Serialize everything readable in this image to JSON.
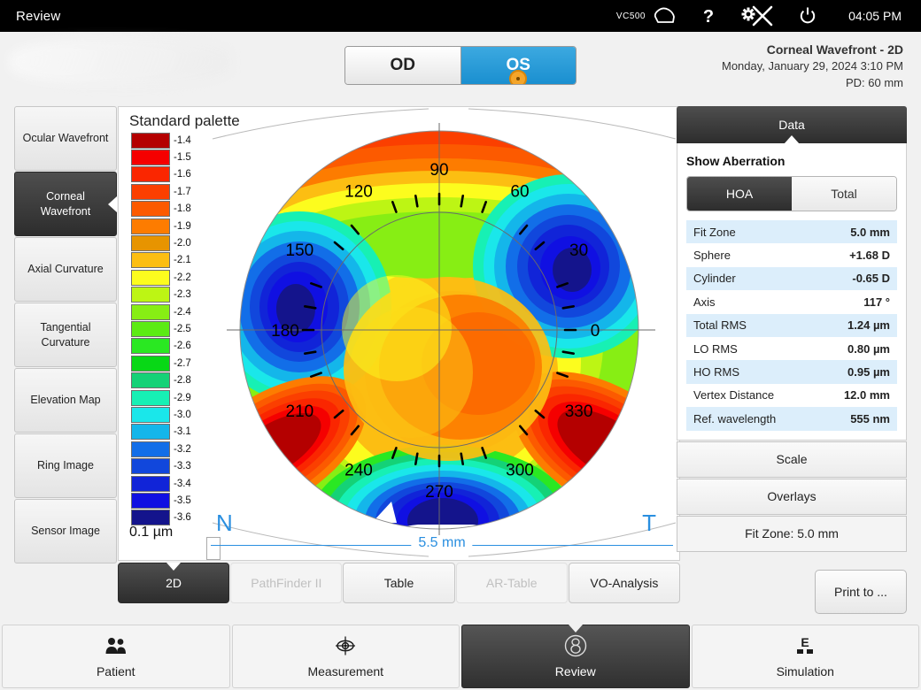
{
  "titlebar": {
    "title": "Review",
    "device_label": "VC500",
    "cloud_icon": "cloud-icon",
    "help_icon": "help-question-icon",
    "settings_disabled_icon": "gear-disabled-icon",
    "power_icon": "power-icon",
    "time": "04:05 PM"
  },
  "header": {
    "eye_od": "OD",
    "eye_os": "OS",
    "selected_eye": "OS",
    "exam_title": "Corneal Wavefront - 2D",
    "exam_datetime": "Monday, January 29, 2024 3:10 PM",
    "pd": "PD: 60 mm"
  },
  "sidebar": {
    "items": [
      {
        "label": "Ocular Wavefront",
        "active": false
      },
      {
        "label": "Corneal Wavefront",
        "active": true
      },
      {
        "label": "Axial Curvature",
        "active": false
      },
      {
        "label": "Tangential Curvature",
        "active": false
      },
      {
        "label": "Elevation Map",
        "active": false
      },
      {
        "label": "Ring Image",
        "active": false
      },
      {
        "label": "Sensor Image",
        "active": false
      }
    ]
  },
  "map": {
    "palette_title": "Standard palette",
    "palette_unit": "0.1 µm",
    "scale_label": "5.5 mm",
    "nasal_label": "N",
    "temporal_label": "T",
    "axis_labels": [
      "0",
      "30",
      "60",
      "90",
      "120",
      "150",
      "180",
      "210",
      "240",
      "270",
      "300",
      "330"
    ],
    "palette_steps": [
      {
        "value": "-1.4",
        "color": "#b40000"
      },
      {
        "value": "-1.5",
        "color": "#f50000"
      },
      {
        "value": "-1.6",
        "color": "#fa2600"
      },
      {
        "value": "-1.7",
        "color": "#fb3f00"
      },
      {
        "value": "-1.8",
        "color": "#fc5a00"
      },
      {
        "value": "-1.9",
        "color": "#fd7c00"
      },
      {
        "value": "-2.0",
        "color": "#e79400"
      },
      {
        "value": "-2.1",
        "color": "#fcbe12"
      },
      {
        "value": "-2.2",
        "color": "#fcfc1e"
      },
      {
        "value": "-2.3",
        "color": "#bdf514"
      },
      {
        "value": "-2.4",
        "color": "#87ee14"
      },
      {
        "value": "-2.5",
        "color": "#5ceb14"
      },
      {
        "value": "-2.6",
        "color": "#2ae822"
      },
      {
        "value": "-2.7",
        "color": "#08d816"
      },
      {
        "value": "-2.8",
        "color": "#14d277"
      },
      {
        "value": "-2.9",
        "color": "#17f0b4"
      },
      {
        "value": "-3.0",
        "color": "#1ae7ea"
      },
      {
        "value": "-3.1",
        "color": "#14b6ea"
      },
      {
        "value": "-3.2",
        "color": "#126ee8"
      },
      {
        "value": "-3.3",
        "color": "#1147dc"
      },
      {
        "value": "-3.4",
        "color": "#1124d8"
      },
      {
        "value": "-3.5",
        "color": "#1010e2"
      },
      {
        "value": "-3.6",
        "color": "#14148c"
      }
    ]
  },
  "view_tabs": [
    {
      "label": "2D",
      "state": "active"
    },
    {
      "label": "PathFinder II",
      "state": "disabled"
    },
    {
      "label": "Table",
      "state": "normal"
    },
    {
      "label": "AR-Table",
      "state": "disabled"
    },
    {
      "label": "VO-Analysis",
      "state": "normal"
    }
  ],
  "data_panel": {
    "tab_title": "Data",
    "section_title": "Show Aberration",
    "seg_hoa": "HOA",
    "seg_total": "Total",
    "selected_seg": "HOA",
    "rows": [
      {
        "key": "Fit Zone",
        "value": "5.0 mm"
      },
      {
        "key": "Sphere",
        "value": "+1.68 D"
      },
      {
        "key": "Cylinder",
        "value": "-0.65 D"
      },
      {
        "key": "Axis",
        "value": "117 °"
      },
      {
        "key": "Total RMS",
        "value": "1.24 µm"
      },
      {
        "key": "LO RMS",
        "value": "0.80 µm"
      },
      {
        "key": "HO RMS",
        "value": "0.95 µm"
      },
      {
        "key": "Vertex Distance",
        "value": "12.0 mm"
      },
      {
        "key": "Ref. wavelength",
        "value": "555 nm"
      }
    ],
    "scale_button": "Scale",
    "overlays_button": "Overlays",
    "fitzone_button": "Fit Zone: 5.0 mm",
    "print_button": "Print to ..."
  },
  "bottom_nav": [
    {
      "label": "Patient",
      "icon": "people-icon",
      "active": false
    },
    {
      "label": "Measurement",
      "icon": "eye-target-icon",
      "active": false
    },
    {
      "label": "Review",
      "icon": "review-circle-icon",
      "active": true
    },
    {
      "label": "Simulation",
      "icon": "eye-chart-icon",
      "active": false
    }
  ]
}
